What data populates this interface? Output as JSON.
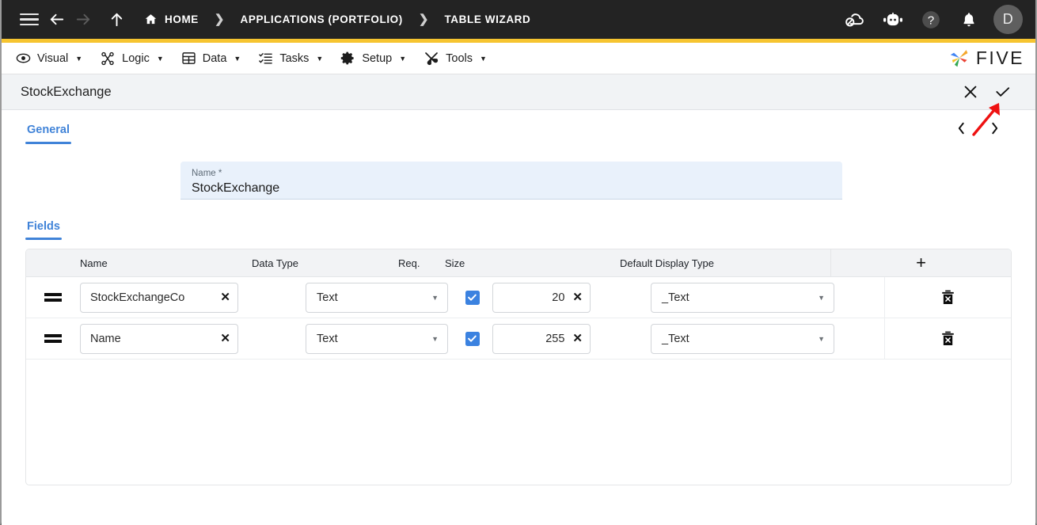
{
  "topbar": {
    "menu_icon": "hamburger-icon",
    "back_icon": "arrow-left-icon",
    "forward_icon": "arrow-right-icon",
    "up_icon": "arrow-up-icon",
    "breadcrumbs": [
      {
        "label": "HOME",
        "icon": "home-icon"
      },
      {
        "label": "APPLICATIONS (PORTFOLIO)",
        "icon": ""
      },
      {
        "label": "TABLE WIZARD",
        "icon": ""
      }
    ],
    "separator": "❯",
    "actions": [
      {
        "name": "cloud-off-icon",
        "label": ""
      },
      {
        "name": "chatbot-icon",
        "label": ""
      },
      {
        "name": "help-icon",
        "label": "?"
      },
      {
        "name": "bell-icon",
        "label": ""
      }
    ],
    "avatar_initial": "D",
    "accent_color": "#f6c430"
  },
  "menubar": {
    "items": [
      {
        "label": "Visual",
        "icon": "eye-icon",
        "caret": "▼"
      },
      {
        "label": "Logic",
        "icon": "logic-nodes-icon",
        "caret": "▼"
      },
      {
        "label": "Data",
        "icon": "table-grid-icon",
        "caret": "▼"
      },
      {
        "label": "Tasks",
        "icon": "task-list-icon",
        "caret": "▼"
      },
      {
        "label": "Setup",
        "icon": "gear-icon",
        "caret": "▼"
      },
      {
        "label": "Tools",
        "icon": "tools-icon",
        "caret": "▼"
      }
    ],
    "brand": "FIVE"
  },
  "window": {
    "title": "StockExchange",
    "close_icon": "close-icon",
    "save_icon": "checkmark-icon"
  },
  "form": {
    "tab": "General",
    "pager_prev": "‹",
    "pager_next": "›",
    "name": {
      "label": "Name *",
      "value": "StockExchange",
      "placeholder": "Name"
    }
  },
  "fields_section": {
    "tab": "Fields",
    "add_label": "+",
    "columns": [
      "Name",
      "Data Type",
      "Req.",
      "Size",
      "Default Display Type"
    ],
    "rows": [
      {
        "handle": "drag-handle-icon",
        "name": "StockExchangeCo",
        "name_placeholder": "Name",
        "data_type": "Text",
        "required": true,
        "size": "20",
        "default_display_type": "_Text",
        "clear_icon": "✕",
        "delete_icon": "trash-icon"
      },
      {
        "handle": "drag-handle-icon",
        "name": "Name",
        "name_placeholder": "Name",
        "data_type": "Text",
        "required": true,
        "size": "255",
        "default_display_type": "_Text",
        "clear_icon": "✕",
        "delete_icon": "trash-icon"
      }
    ]
  },
  "annotation": {
    "type": "arrow",
    "color": "#ee1111",
    "points_to": "save-checkmark-button"
  },
  "colors": {
    "accent_blue": "#4083d8",
    "checkbox_blue": "#3b82e0",
    "topbar_dark": "#232323",
    "gold": "#f6c430",
    "field_bg": "#e9f1fb"
  }
}
